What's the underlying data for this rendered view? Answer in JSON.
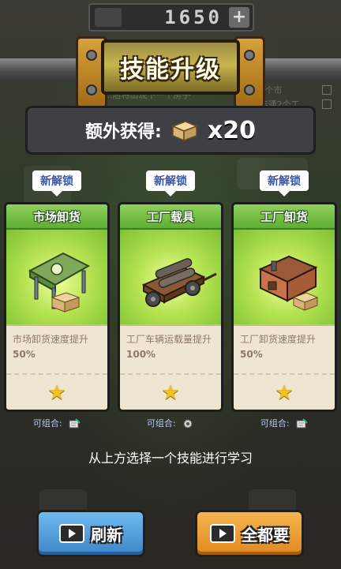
{
  "top_counter": {
    "value": "1650",
    "plus_label": "+"
  },
  "banner": {
    "title": "技能升级"
  },
  "extra_reward": {
    "label": "额外获得:",
    "multiplier": "x20",
    "icon": "crate-icon"
  },
  "background_text": {
    "line1": "...后将出现下一个房子",
    "line2": "...2个市",
    "line3": "...连通2个工"
  },
  "cards": [
    {
      "tag": "新解锁",
      "title": "市场卸货",
      "desc": "市场卸货速度提升",
      "value": "50%",
      "combo_label": "可组合:",
      "art": "market-shed-icon",
      "combo_icon": "document-pen-icon"
    },
    {
      "tag": "新解锁",
      "title": "工厂载具",
      "desc": "工厂车辆运载量提升",
      "value": "100%",
      "combo_label": "可组合:",
      "art": "cart-logs-icon",
      "combo_icon": "gear-icon"
    },
    {
      "tag": "新解锁",
      "title": "工厂卸货",
      "desc": "工厂卸货速度提升",
      "value": "50%",
      "combo_label": "可组合:",
      "art": "factory-house-icon",
      "combo_icon": "document-pen-icon"
    }
  ],
  "hint": "从上方选择一个技能进行学习",
  "buttons": {
    "refresh": {
      "label": "刷新",
      "icon": "video-ad-icon"
    },
    "take_all": {
      "label": "全都要",
      "icon": "video-ad-icon"
    }
  },
  "colors": {
    "card_header_green": "#6fbd3f",
    "tag_text_blue": "#3a55a6",
    "refresh_blue": "#4d97d8",
    "take_all_orange": "#ec9a2e",
    "star_yellow": "#f2c21e"
  }
}
